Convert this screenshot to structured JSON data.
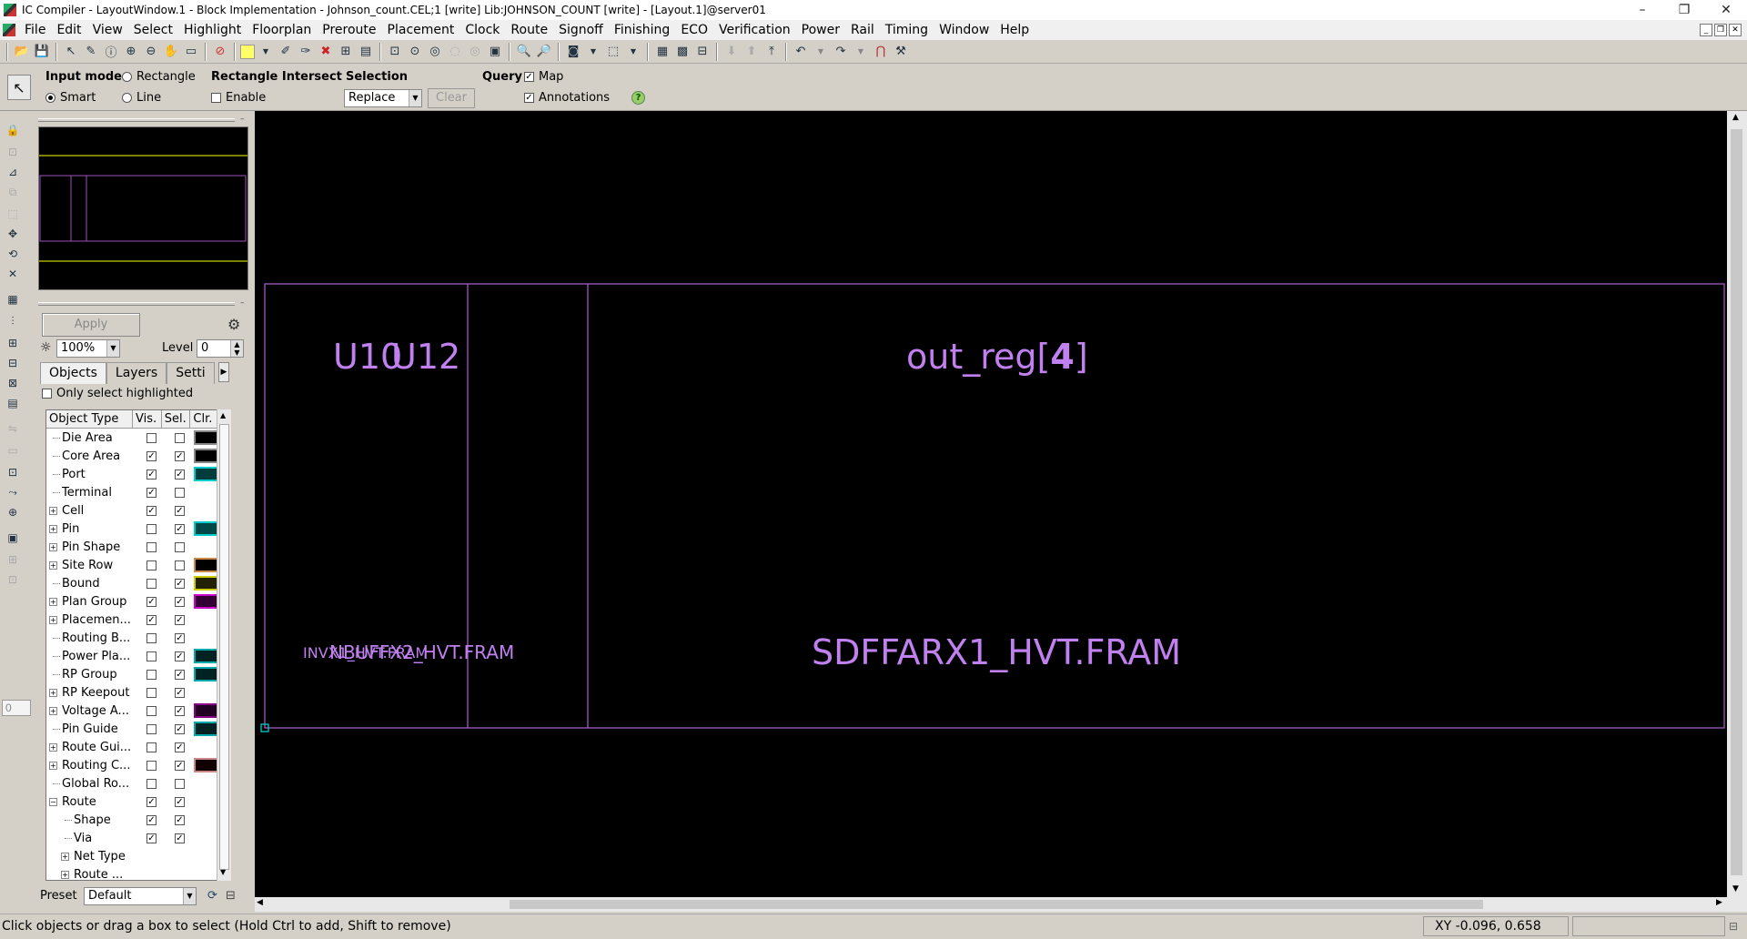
{
  "window": {
    "title": "IC Compiler - LayoutWindow.1 - Block Implementation - Johnson_count.CEL;1 [write]    Lib:JOHNSON_COUNT [write] - [Layout.1]@server01",
    "minimize": "–",
    "restore": "❐",
    "close": "✕"
  },
  "menu": [
    "File",
    "Edit",
    "View",
    "Select",
    "Highlight",
    "Floorplan",
    "Preroute",
    "Placement",
    "Clock",
    "Route",
    "Signoff",
    "Finishing",
    "ECO",
    "Verification",
    "Power",
    "Rail",
    "Timing",
    "Window",
    "Help"
  ],
  "modebar": {
    "input_mode_label": "Input mode",
    "rectangle": "Rectangle",
    "smart": "Smart",
    "line": "Line",
    "rect_intersect_label": "Rectangle Intersect",
    "enable": "Enable",
    "selection_label": "Selection",
    "selection_value": "Replace",
    "clear": "Clear",
    "query_label": "Query",
    "map": "Map",
    "annotations": "Annotations",
    "help_icon": "?"
  },
  "panel": {
    "apply": "Apply",
    "zoom_value": "100%",
    "level_label": "Level",
    "level_value": "0",
    "tabs": [
      "Objects",
      "Layers",
      "Setti"
    ],
    "only_select": "Only select highlighted",
    "columns": [
      "Object Type",
      "Vis.",
      "Sel.",
      "Clr."
    ],
    "rows": [
      {
        "name": "Die Area",
        "exp": "",
        "vis": false,
        "sel": false,
        "clr": "#000000",
        "clr_border": "#888888",
        "indent": 0
      },
      {
        "name": "Core Area",
        "exp": "",
        "vis": true,
        "sel": true,
        "clr": "#000000",
        "clr_border": "#888888",
        "indent": 0
      },
      {
        "name": "Port",
        "exp": "",
        "vis": true,
        "sel": true,
        "clr": "#003c3c",
        "clr_border": "#00cccc",
        "indent": 0
      },
      {
        "name": "Terminal",
        "exp": "",
        "vis": true,
        "sel": false,
        "clr": "",
        "clr_border": "",
        "indent": 0
      },
      {
        "name": "Cell",
        "exp": "+",
        "vis": true,
        "sel": true,
        "clr": "",
        "clr_border": "",
        "indent": 0
      },
      {
        "name": "Pin",
        "exp": "+",
        "vis": false,
        "sel": true,
        "clr": "#004848",
        "clr_border": "#00cccc",
        "indent": 0
      },
      {
        "name": "Pin Shape",
        "exp": "+",
        "vis": false,
        "sel": false,
        "clr": "",
        "clr_border": "",
        "indent": 0
      },
      {
        "name": "Site Row",
        "exp": "+",
        "vis": false,
        "sel": false,
        "clr": "#000000",
        "clr_border": "#cc8844",
        "indent": 0
      },
      {
        "name": "Bound",
        "exp": "",
        "vis": false,
        "sel": true,
        "clr": "#222200",
        "clr_border": "#cccc00",
        "indent": 0
      },
      {
        "name": "Plan Group",
        "exp": "+",
        "vis": true,
        "sel": true,
        "clr": "#330033",
        "clr_border": "#cc00cc",
        "indent": 0
      },
      {
        "name": "Placemen...",
        "exp": "+",
        "vis": true,
        "sel": true,
        "clr": "",
        "clr_border": "",
        "indent": 0
      },
      {
        "name": "Routing B...",
        "exp": "",
        "vis": false,
        "sel": true,
        "clr": "",
        "clr_border": "",
        "indent": 0
      },
      {
        "name": "Power Pla...",
        "exp": "",
        "vis": false,
        "sel": true,
        "clr": "#002222",
        "clr_border": "#00aaaa",
        "indent": 0
      },
      {
        "name": "RP Group",
        "exp": "",
        "vis": false,
        "sel": true,
        "clr": "#002222",
        "clr_border": "#00aaaa",
        "indent": 0
      },
      {
        "name": "RP Keepout",
        "exp": "+",
        "vis": false,
        "sel": true,
        "clr": "",
        "clr_border": "",
        "indent": 0
      },
      {
        "name": "Voltage A...",
        "exp": "+",
        "vis": false,
        "sel": true,
        "clr": "#220022",
        "clr_border": "#880088",
        "indent": 0
      },
      {
        "name": "Pin Guide",
        "exp": "",
        "vis": false,
        "sel": true,
        "clr": "#002222",
        "clr_border": "#00aaaa",
        "indent": 0
      },
      {
        "name": "Route Gui...",
        "exp": "+",
        "vis": false,
        "sel": true,
        "clr": "",
        "clr_border": "",
        "indent": 0
      },
      {
        "name": "Routing C...",
        "exp": "+",
        "vis": false,
        "sel": true,
        "clr": "#100000",
        "clr_border": "#cc8888",
        "indent": 0
      },
      {
        "name": "Global Ro...",
        "exp": "",
        "vis": false,
        "sel": false,
        "clr": "",
        "clr_border": "",
        "indent": 0
      },
      {
        "name": "Route",
        "exp": "−",
        "vis": true,
        "sel": true,
        "clr": "",
        "clr_border": "",
        "indent": 0
      },
      {
        "name": "Shape",
        "exp": "",
        "vis": true,
        "sel": true,
        "clr": "",
        "clr_border": "",
        "indent": 1
      },
      {
        "name": "Via",
        "exp": "",
        "vis": true,
        "sel": true,
        "clr": "",
        "clr_border": "",
        "indent": 1
      },
      {
        "name": "Net Type",
        "exp": "+",
        "vis": null,
        "sel": null,
        "clr": "",
        "clr_border": "",
        "indent": 1
      },
      {
        "name": "Route ...",
        "exp": "+",
        "vis": null,
        "sel": null,
        "clr": "",
        "clr_border": "",
        "indent": 1
      }
    ],
    "preset_label": "Preset",
    "preset_value": "Default"
  },
  "layout": {
    "label_u10": "U10",
    "label_u12": "U12",
    "label_out_reg": "out_reg[",
    "label_out_reg_idx": "4",
    "label_out_reg_end": "]",
    "label_inv": "INVX1_HVT.FRAM",
    "label_nbuff": "NBUFFX2_HVT.FRAM",
    "label_sdff": "SDFFARX1_HVT.FRAM",
    "outline_color": "#b060d0",
    "text_color": "#c080f0"
  },
  "status": {
    "message": "Click objects or drag a box to select (Hold Ctrl to add, Shift to remove)",
    "xy": "XY -0.096, 0.658"
  }
}
